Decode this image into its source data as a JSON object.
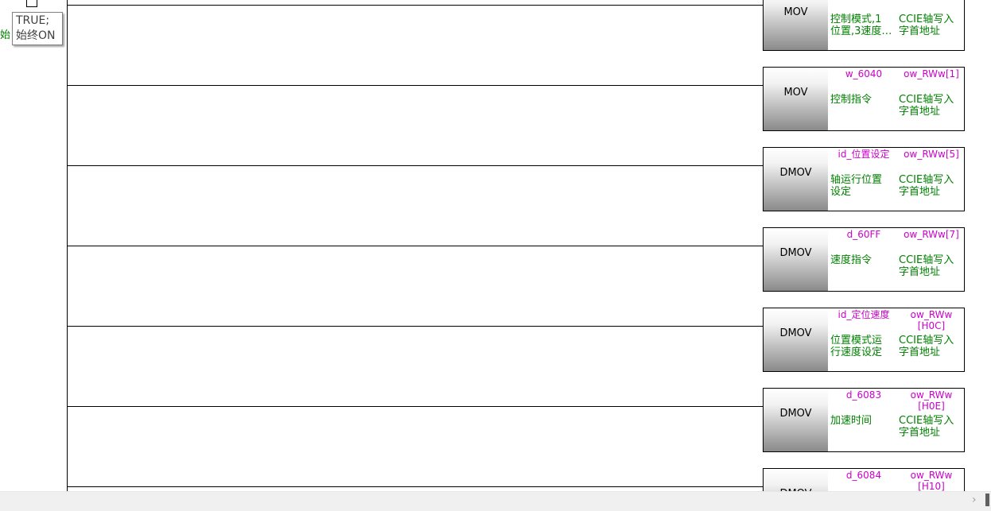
{
  "contact": {
    "cut_label": "始",
    "tooltip_line1": "TRUE;",
    "tooltip_line2": "始终ON"
  },
  "blocks": [
    {
      "op": "MOV",
      "in_var": "",
      "out_var": "",
      "in_comment": "控制模式,1\n位置,3速度…",
      "out_comment": "CCIE轴写入\n字首地址"
    },
    {
      "op": "MOV",
      "in_var": "w_6040",
      "out_var": "ow_RWw[1]",
      "in_comment": "控制指令",
      "out_comment": "CCIE轴写入\n字首地址"
    },
    {
      "op": "DMOV",
      "in_var": "id_位置设定",
      "out_var": "ow_RWw[5]",
      "in_comment": "轴运行位置\n设定",
      "out_comment": "CCIE轴写入\n字首地址"
    },
    {
      "op": "DMOV",
      "in_var": "d_60FF",
      "out_var": "ow_RWw[7]",
      "in_comment": "速度指令",
      "out_comment": "CCIE轴写入\n字首地址"
    },
    {
      "op": "DMOV",
      "in_var": "id_定位速度",
      "out_var": "ow_RWw\n[H0C]",
      "in_comment": "位置模式运\n行速度设定",
      "out_comment": "CCIE轴写入\n字首地址"
    },
    {
      "op": "DMOV",
      "in_var": "d_6083",
      "out_var": "ow_RWw\n[H0E]",
      "in_comment": "加速时间",
      "out_comment": "CCIE轴写入\n字首地址"
    },
    {
      "op": "DMOV",
      "in_var": "d_6084",
      "out_var": "ow_RWw\n[H10]",
      "in_comment": "",
      "out_comment": ""
    }
  ],
  "scrollbar": {
    "arrow_icon": "chevron-right-icon"
  }
}
